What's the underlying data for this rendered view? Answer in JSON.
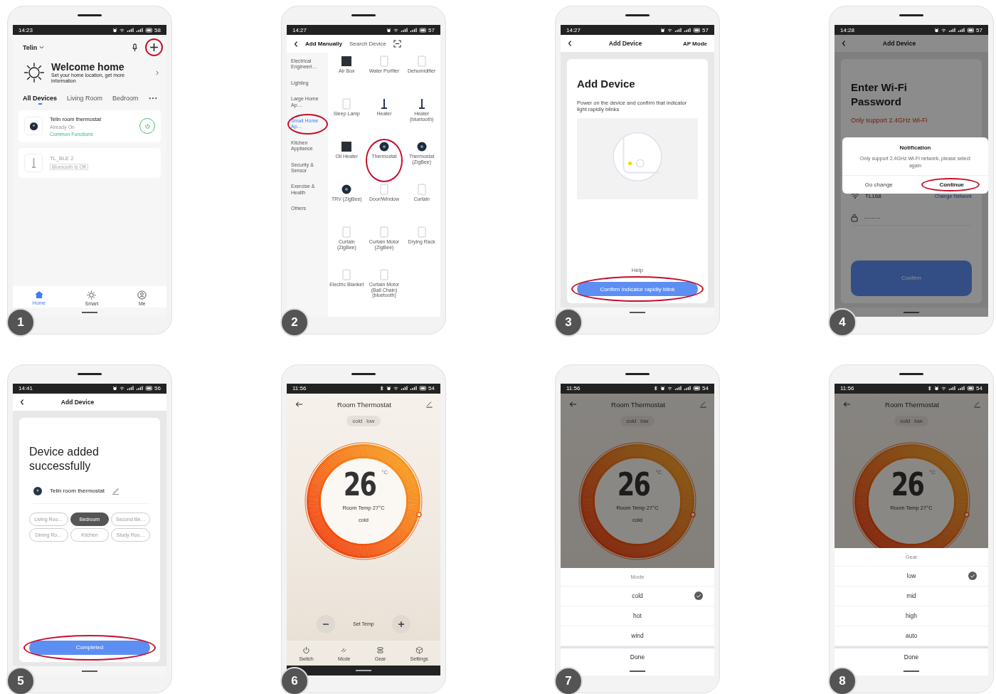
{
  "phones": [
    {
      "step": "1",
      "kind": "home",
      "status": {
        "time": "14:23",
        "battery": "58",
        "bluetooth": false
      },
      "home": "Telin",
      "add_circled": true,
      "welcome": {
        "title": "Welcome home",
        "subtitle": "Set your home location, get more information"
      },
      "tabs": [
        {
          "label": "All Devices",
          "selected": true
        },
        {
          "label": "Living Room",
          "selected": false
        },
        {
          "label": "Bedroom",
          "selected": false
        }
      ],
      "devices": [
        {
          "name": "Telin room thermostat",
          "status": "Already On",
          "link": "Common Functions",
          "offline": false
        },
        {
          "name": "TL_BLE 2",
          "badge": "Bluetooth is Off",
          "offline": true
        }
      ],
      "nav": [
        {
          "kind": "home",
          "label": "Home",
          "selected": true
        },
        {
          "kind": "smart",
          "label": "Smart",
          "selected": false
        },
        {
          "kind": "me",
          "label": "Me",
          "selected": false
        }
      ]
    },
    {
      "step": "2",
      "kind": "add_manually",
      "status": {
        "time": "14:27",
        "battery": "57",
        "bluetooth": false
      },
      "tabs": [
        {
          "label": "Add Manually",
          "selected": true
        },
        {
          "label": "Search Device",
          "selected": false
        }
      ],
      "categories": [
        {
          "label": "Electrical Engineeri…",
          "selected": false,
          "circled": false
        },
        {
          "label": "Lighting",
          "selected": false,
          "circled": false
        },
        {
          "label": "Large Home Ap…",
          "selected": false,
          "circled": false
        },
        {
          "label": "Small Home Ap…",
          "selected": true,
          "circled": true
        },
        {
          "label": "Kitchen Appliance",
          "selected": false,
          "circled": false
        },
        {
          "label": "Security & Sensor",
          "selected": false,
          "circled": false
        },
        {
          "label": "Exercise & Health",
          "selected": false,
          "circled": false
        },
        {
          "label": "Others",
          "selected": false,
          "circled": false
        }
      ],
      "products": [
        {
          "name": "Air Box",
          "kind": "dark",
          "circled": false
        },
        {
          "name": "Water Purifier",
          "kind": "white",
          "circled": false
        },
        {
          "name": "Dehumidifier",
          "kind": "white",
          "circled": false
        },
        {
          "name": "Sleep Lamp",
          "kind": "white",
          "circled": false
        },
        {
          "name": "Heater",
          "kind": "stand",
          "circled": false
        },
        {
          "name": "Heater (bluetooth)",
          "kind": "stand",
          "circled": false
        },
        {
          "name": "Oil Heater",
          "kind": "dark",
          "circled": false
        },
        {
          "name": "Thermostat",
          "kind": "dial",
          "circled": true
        },
        {
          "name": "Thermostat (ZigBee)",
          "kind": "dial",
          "circled": false
        },
        {
          "name": "TRV (ZigBee)",
          "kind": "dial",
          "circled": false
        },
        {
          "name": "Door/Window",
          "kind": "white",
          "circled": false
        },
        {
          "name": "Curtain",
          "kind": "white",
          "circled": false
        },
        {
          "name": "Curtain (ZigBee)",
          "kind": "white",
          "circled": false
        },
        {
          "name": "Curtain Motor (ZigBee)",
          "kind": "white",
          "circled": false
        },
        {
          "name": "Drying Rack",
          "kind": "white",
          "circled": false
        },
        {
          "name": "Electric Blanket",
          "kind": "white",
          "circled": false
        },
        {
          "name": "Curtain Motor (Ball Chain) (bluetooth)",
          "kind": "white",
          "circled": false
        }
      ]
    },
    {
      "step": "3",
      "kind": "add_device",
      "status": {
        "time": "14:27",
        "battery": "57",
        "bluetooth": false
      },
      "header": {
        "title": "Add Device",
        "action": "AP Mode"
      },
      "card": {
        "title": "Add Device",
        "text": "Power on the device and confirm that indicator light rapidly blinks",
        "help": "Help",
        "button": "Confirm indicator rapidly blink",
        "button_circled": true
      }
    },
    {
      "step": "4",
      "kind": "wifi_password",
      "status": {
        "time": "14:28",
        "battery": "57",
        "bluetooth": false
      },
      "dimmed": true,
      "header": {
        "title": "Add Device"
      },
      "title": "Enter Wi-Fi Password",
      "warning": "Only support 2.4GHz Wi-Fi",
      "network": "TL168",
      "change": "Change Network",
      "password": "·········",
      "button": "Confirm",
      "dialog": {
        "title": "Notification",
        "message": "Only support 2.4GHz Wi-Fi network, please select again",
        "buttons": [
          {
            "label": "Go change",
            "primary": false,
            "circled": false
          },
          {
            "label": "Continue",
            "primary": true,
            "circled": true
          }
        ]
      }
    },
    {
      "step": "5",
      "kind": "device_added",
      "status": {
        "time": "14:41",
        "battery": "56",
        "bluetooth": false
      },
      "header": {
        "title": "Add Device"
      },
      "title": "Device added successfully",
      "device": "Telin room thermostat",
      "rooms": [
        {
          "label": "Living Roo…",
          "selected": false
        },
        {
          "label": "Bedroom",
          "selected": true
        },
        {
          "label": "Second Be…",
          "selected": false
        },
        {
          "label": "Dining Ro…",
          "selected": false
        },
        {
          "label": "Kitchen",
          "selected": false
        },
        {
          "label": "Study Roo…",
          "selected": false
        }
      ],
      "button": "Completed",
      "button_circled": true
    },
    {
      "step": "6",
      "kind": "thermostat",
      "status": {
        "time": "11:56",
        "battery": "54",
        "bluetooth": true
      },
      "dimmed": false,
      "title": "Room Thermostat",
      "chip": [
        "cold",
        "low"
      ],
      "temp": "26",
      "unit": "°C",
      "room_temp": "Room Temp 27°C",
      "mode": "cold",
      "set_temp": "Set Temp",
      "tabs": [
        {
          "kind": "switch",
          "label": "Switch"
        },
        {
          "kind": "mode",
          "label": "Mode"
        },
        {
          "kind": "gear",
          "label": "Gear"
        },
        {
          "kind": "settings",
          "label": "Settings"
        }
      ]
    },
    {
      "step": "7",
      "kind": "thermostat",
      "status": {
        "time": "11:56",
        "battery": "54",
        "bluetooth": true
      },
      "dimmed": true,
      "title": "Room Thermostat",
      "chip": [
        "cold",
        "low"
      ],
      "temp": "26",
      "unit": "°C",
      "room_temp": "Room Temp 27°C",
      "mode": "cold",
      "sheet": {
        "title": "Mode",
        "options": [
          {
            "label": "cold",
            "selected": true
          },
          {
            "label": "hot",
            "selected": false
          },
          {
            "label": "wind",
            "selected": false
          }
        ],
        "done": "Done"
      }
    },
    {
      "step": "8",
      "kind": "thermostat",
      "status": {
        "time": "11:56",
        "battery": "54",
        "bluetooth": true
      },
      "dimmed": true,
      "title": "Room Thermostat",
      "chip": [
        "cold",
        "low"
      ],
      "temp": "26",
      "unit": "°C",
      "room_temp": "Room Temp 27°C",
      "sheet": {
        "title": "Gear",
        "options": [
          {
            "label": "low",
            "selected": true
          },
          {
            "label": "mid",
            "selected": false
          },
          {
            "label": "high",
            "selected": false
          },
          {
            "label": "auto",
            "selected": false
          }
        ],
        "done": "Done"
      }
    }
  ]
}
